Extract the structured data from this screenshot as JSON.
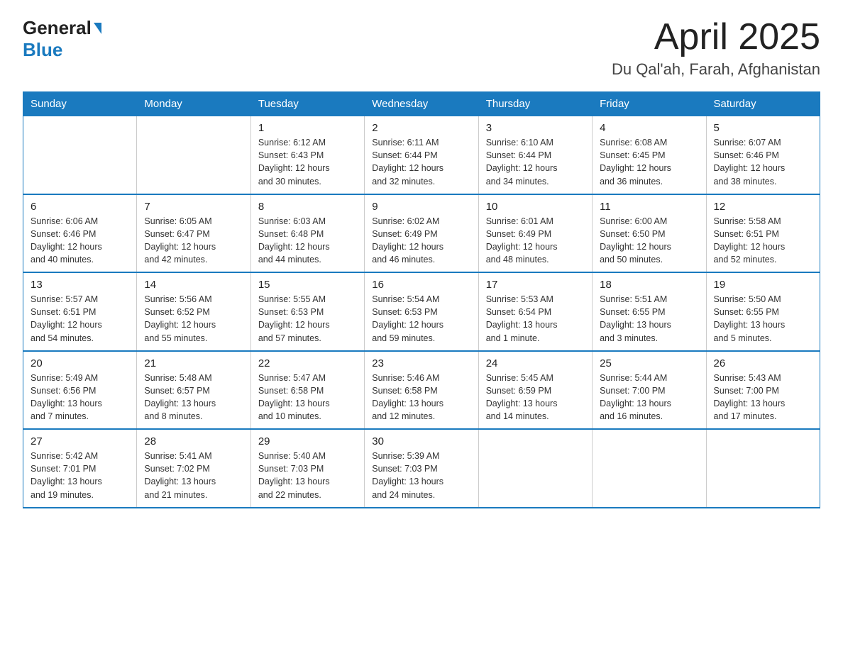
{
  "header": {
    "logo_general": "General",
    "logo_blue": "Blue",
    "title": "April 2025",
    "subtitle": "Du Qal'ah, Farah, Afghanistan"
  },
  "days_of_week": [
    "Sunday",
    "Monday",
    "Tuesday",
    "Wednesday",
    "Thursday",
    "Friday",
    "Saturday"
  ],
  "weeks": [
    [
      {
        "num": "",
        "info": ""
      },
      {
        "num": "",
        "info": ""
      },
      {
        "num": "1",
        "info": "Sunrise: 6:12 AM\nSunset: 6:43 PM\nDaylight: 12 hours\nand 30 minutes."
      },
      {
        "num": "2",
        "info": "Sunrise: 6:11 AM\nSunset: 6:44 PM\nDaylight: 12 hours\nand 32 minutes."
      },
      {
        "num": "3",
        "info": "Sunrise: 6:10 AM\nSunset: 6:44 PM\nDaylight: 12 hours\nand 34 minutes."
      },
      {
        "num": "4",
        "info": "Sunrise: 6:08 AM\nSunset: 6:45 PM\nDaylight: 12 hours\nand 36 minutes."
      },
      {
        "num": "5",
        "info": "Sunrise: 6:07 AM\nSunset: 6:46 PM\nDaylight: 12 hours\nand 38 minutes."
      }
    ],
    [
      {
        "num": "6",
        "info": "Sunrise: 6:06 AM\nSunset: 6:46 PM\nDaylight: 12 hours\nand 40 minutes."
      },
      {
        "num": "7",
        "info": "Sunrise: 6:05 AM\nSunset: 6:47 PM\nDaylight: 12 hours\nand 42 minutes."
      },
      {
        "num": "8",
        "info": "Sunrise: 6:03 AM\nSunset: 6:48 PM\nDaylight: 12 hours\nand 44 minutes."
      },
      {
        "num": "9",
        "info": "Sunrise: 6:02 AM\nSunset: 6:49 PM\nDaylight: 12 hours\nand 46 minutes."
      },
      {
        "num": "10",
        "info": "Sunrise: 6:01 AM\nSunset: 6:49 PM\nDaylight: 12 hours\nand 48 minutes."
      },
      {
        "num": "11",
        "info": "Sunrise: 6:00 AM\nSunset: 6:50 PM\nDaylight: 12 hours\nand 50 minutes."
      },
      {
        "num": "12",
        "info": "Sunrise: 5:58 AM\nSunset: 6:51 PM\nDaylight: 12 hours\nand 52 minutes."
      }
    ],
    [
      {
        "num": "13",
        "info": "Sunrise: 5:57 AM\nSunset: 6:51 PM\nDaylight: 12 hours\nand 54 minutes."
      },
      {
        "num": "14",
        "info": "Sunrise: 5:56 AM\nSunset: 6:52 PM\nDaylight: 12 hours\nand 55 minutes."
      },
      {
        "num": "15",
        "info": "Sunrise: 5:55 AM\nSunset: 6:53 PM\nDaylight: 12 hours\nand 57 minutes."
      },
      {
        "num": "16",
        "info": "Sunrise: 5:54 AM\nSunset: 6:53 PM\nDaylight: 12 hours\nand 59 minutes."
      },
      {
        "num": "17",
        "info": "Sunrise: 5:53 AM\nSunset: 6:54 PM\nDaylight: 13 hours\nand 1 minute."
      },
      {
        "num": "18",
        "info": "Sunrise: 5:51 AM\nSunset: 6:55 PM\nDaylight: 13 hours\nand 3 minutes."
      },
      {
        "num": "19",
        "info": "Sunrise: 5:50 AM\nSunset: 6:55 PM\nDaylight: 13 hours\nand 5 minutes."
      }
    ],
    [
      {
        "num": "20",
        "info": "Sunrise: 5:49 AM\nSunset: 6:56 PM\nDaylight: 13 hours\nand 7 minutes."
      },
      {
        "num": "21",
        "info": "Sunrise: 5:48 AM\nSunset: 6:57 PM\nDaylight: 13 hours\nand 8 minutes."
      },
      {
        "num": "22",
        "info": "Sunrise: 5:47 AM\nSunset: 6:58 PM\nDaylight: 13 hours\nand 10 minutes."
      },
      {
        "num": "23",
        "info": "Sunrise: 5:46 AM\nSunset: 6:58 PM\nDaylight: 13 hours\nand 12 minutes."
      },
      {
        "num": "24",
        "info": "Sunrise: 5:45 AM\nSunset: 6:59 PM\nDaylight: 13 hours\nand 14 minutes."
      },
      {
        "num": "25",
        "info": "Sunrise: 5:44 AM\nSunset: 7:00 PM\nDaylight: 13 hours\nand 16 minutes."
      },
      {
        "num": "26",
        "info": "Sunrise: 5:43 AM\nSunset: 7:00 PM\nDaylight: 13 hours\nand 17 minutes."
      }
    ],
    [
      {
        "num": "27",
        "info": "Sunrise: 5:42 AM\nSunset: 7:01 PM\nDaylight: 13 hours\nand 19 minutes."
      },
      {
        "num": "28",
        "info": "Sunrise: 5:41 AM\nSunset: 7:02 PM\nDaylight: 13 hours\nand 21 minutes."
      },
      {
        "num": "29",
        "info": "Sunrise: 5:40 AM\nSunset: 7:03 PM\nDaylight: 13 hours\nand 22 minutes."
      },
      {
        "num": "30",
        "info": "Sunrise: 5:39 AM\nSunset: 7:03 PM\nDaylight: 13 hours\nand 24 minutes."
      },
      {
        "num": "",
        "info": ""
      },
      {
        "num": "",
        "info": ""
      },
      {
        "num": "",
        "info": ""
      }
    ]
  ]
}
